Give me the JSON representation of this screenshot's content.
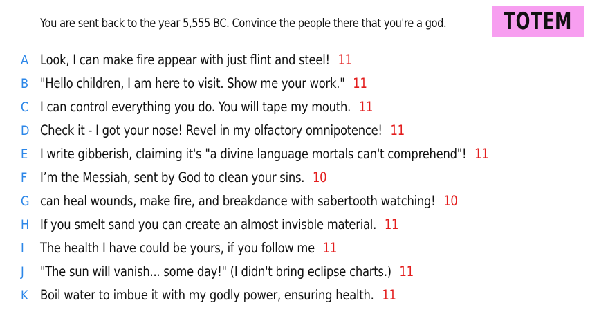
{
  "prompt": "You are sent back to the year 5,555 BC. Convince the people there that you're a god.",
  "logo": "TOTEM",
  "colors": {
    "letter": "#2b86e8",
    "score": "#e31d1d",
    "logo_bg": "#f79ef0"
  },
  "answers": [
    {
      "letter": "A",
      "text": "Look, I can make fire appear with just flint and steel!",
      "score": "11"
    },
    {
      "letter": "B",
      "text": "\"Hello children, I am here to visit. Show me your work.\"",
      "score": "11"
    },
    {
      "letter": "C",
      "text": "I can control everything you do. You will tape my mouth.",
      "score": "11"
    },
    {
      "letter": "D",
      "text": "Check it - I got your nose! Revel in my olfactory omnipotence!",
      "score": "11"
    },
    {
      "letter": "E",
      "text": "I write gibberish, claiming it's \"a divine language mortals can't comprehend\"!",
      "score": "11"
    },
    {
      "letter": "F",
      "text": "I’m the Messiah, sent by God to clean your sins.",
      "score": "10"
    },
    {
      "letter": "G",
      "text": "can heal wounds, make fire, and breakdance with sabertooth watching!",
      "score": "10"
    },
    {
      "letter": "H",
      "text": "If you smelt sand you can create an almost invisble material.",
      "score": "11"
    },
    {
      "letter": "I",
      "text": "The health I have could be yours, if you follow me",
      "score": "11"
    },
    {
      "letter": "J",
      "text": "\"The sun will vanish... some day!\" (I didn't bring eclipse charts.)",
      "score": "11"
    },
    {
      "letter": "K",
      "text": "Boil water to imbue it with my godly power, ensuring health.",
      "score": "11"
    }
  ]
}
